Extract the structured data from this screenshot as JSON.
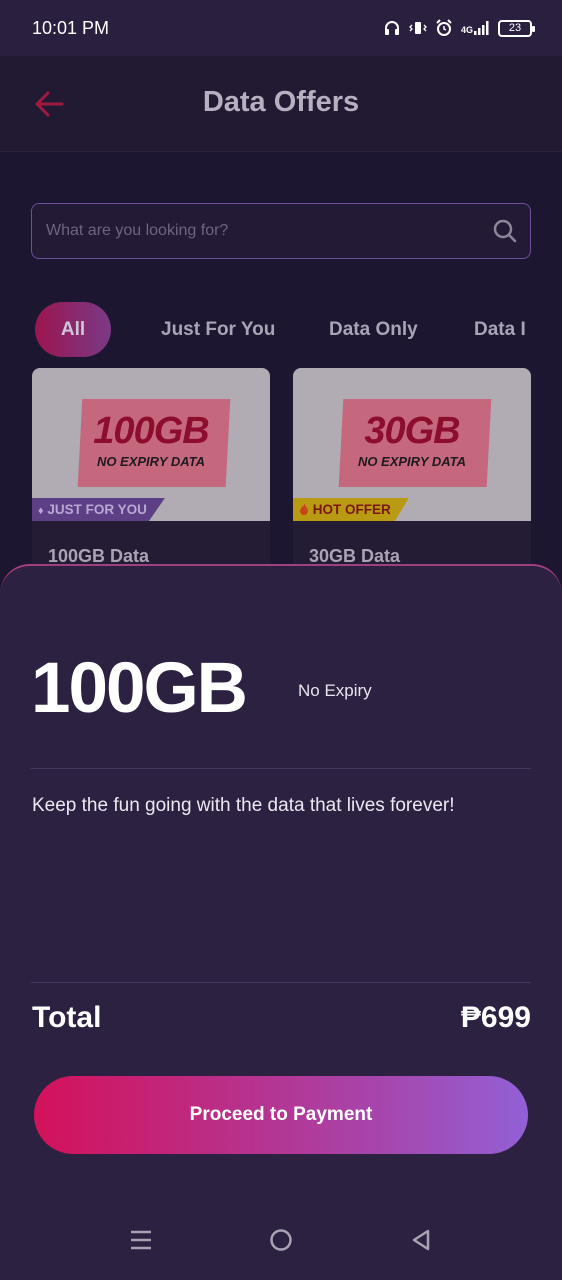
{
  "status_bar": {
    "time": "10:01 PM",
    "network": "4G",
    "battery": "23",
    "icons": [
      "headphones-icon",
      "vibrate-icon",
      "alarm-icon",
      "signal-icon",
      "battery-icon"
    ]
  },
  "header": {
    "title": "Data Offers",
    "back_icon": "back-arrow-icon"
  },
  "search": {
    "placeholder": "What are you looking for?"
  },
  "tabs": [
    {
      "label": "All",
      "active": true
    },
    {
      "label": "Just For You",
      "active": false
    },
    {
      "label": "Data Only",
      "active": false
    },
    {
      "label": "Data I",
      "active": false
    }
  ],
  "offers": [
    {
      "banner_size": "100GB",
      "banner_sub": "NO EXPIRY DATA",
      "tag": "JUST FOR YOU",
      "tag_icon": "diamond-icon",
      "name": "100GB Data"
    },
    {
      "banner_size": "30GB",
      "banner_sub": "NO EXPIRY DATA",
      "tag": "HOT OFFER",
      "tag_icon": "fire-icon",
      "name": "30GB Data"
    }
  ],
  "sheet": {
    "size": "100GB",
    "validity": "No Expiry",
    "description": "Keep the fun going with the data that lives forever!",
    "total_label": "Total",
    "total_amount": "₱699",
    "button_label": "Proceed to Payment"
  },
  "colors": {
    "accent": "#d4115a",
    "accent_end": "#9260d6",
    "sheet_bg": "#2c2140",
    "page_bg": "#1d1630"
  }
}
